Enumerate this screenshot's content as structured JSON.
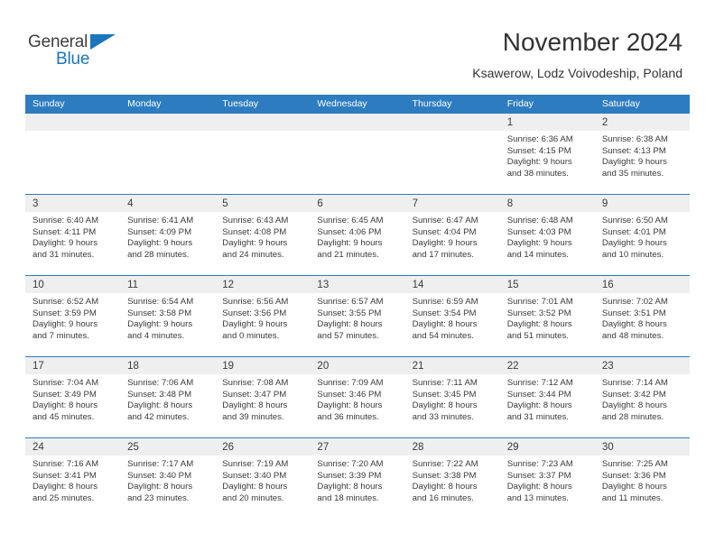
{
  "logo": {
    "word1": "General",
    "word2": "Blue",
    "triangle_color": "#1a75bb",
    "word1_color": "#3d3d3d",
    "word2_color": "#1a75bb"
  },
  "header": {
    "title": "November 2024",
    "subtitle": "Ksawerow, Lodz Voivodeship, Poland"
  },
  "theme": {
    "header_bg": "#2e7cc0",
    "header_text": "#ffffff",
    "day_band_bg": "#efefef",
    "cell_bg": "#ffffff",
    "text": "#3a3a3a"
  },
  "weekday_headers": [
    "Sunday",
    "Monday",
    "Tuesday",
    "Wednesday",
    "Thursday",
    "Friday",
    "Saturday"
  ],
  "weeks": [
    [
      {
        "day": "",
        "empty": true
      },
      {
        "day": "",
        "empty": true
      },
      {
        "day": "",
        "empty": true
      },
      {
        "day": "",
        "empty": true
      },
      {
        "day": "",
        "empty": true
      },
      {
        "day": "1",
        "sunrise": "Sunrise: 6:36 AM",
        "sunset": "Sunset: 4:15 PM",
        "daylight1": "Daylight: 9 hours",
        "daylight2": "and 38 minutes."
      },
      {
        "day": "2",
        "sunrise": "Sunrise: 6:38 AM",
        "sunset": "Sunset: 4:13 PM",
        "daylight1": "Daylight: 9 hours",
        "daylight2": "and 35 minutes."
      }
    ],
    [
      {
        "day": "3",
        "sunrise": "Sunrise: 6:40 AM",
        "sunset": "Sunset: 4:11 PM",
        "daylight1": "Daylight: 9 hours",
        "daylight2": "and 31 minutes."
      },
      {
        "day": "4",
        "sunrise": "Sunrise: 6:41 AM",
        "sunset": "Sunset: 4:09 PM",
        "daylight1": "Daylight: 9 hours",
        "daylight2": "and 28 minutes."
      },
      {
        "day": "5",
        "sunrise": "Sunrise: 6:43 AM",
        "sunset": "Sunset: 4:08 PM",
        "daylight1": "Daylight: 9 hours",
        "daylight2": "and 24 minutes."
      },
      {
        "day": "6",
        "sunrise": "Sunrise: 6:45 AM",
        "sunset": "Sunset: 4:06 PM",
        "daylight1": "Daylight: 9 hours",
        "daylight2": "and 21 minutes."
      },
      {
        "day": "7",
        "sunrise": "Sunrise: 6:47 AM",
        "sunset": "Sunset: 4:04 PM",
        "daylight1": "Daylight: 9 hours",
        "daylight2": "and 17 minutes."
      },
      {
        "day": "8",
        "sunrise": "Sunrise: 6:48 AM",
        "sunset": "Sunset: 4:03 PM",
        "daylight1": "Daylight: 9 hours",
        "daylight2": "and 14 minutes."
      },
      {
        "day": "9",
        "sunrise": "Sunrise: 6:50 AM",
        "sunset": "Sunset: 4:01 PM",
        "daylight1": "Daylight: 9 hours",
        "daylight2": "and 10 minutes."
      }
    ],
    [
      {
        "day": "10",
        "sunrise": "Sunrise: 6:52 AM",
        "sunset": "Sunset: 3:59 PM",
        "daylight1": "Daylight: 9 hours",
        "daylight2": "and 7 minutes."
      },
      {
        "day": "11",
        "sunrise": "Sunrise: 6:54 AM",
        "sunset": "Sunset: 3:58 PM",
        "daylight1": "Daylight: 9 hours",
        "daylight2": "and 4 minutes."
      },
      {
        "day": "12",
        "sunrise": "Sunrise: 6:56 AM",
        "sunset": "Sunset: 3:56 PM",
        "daylight1": "Daylight: 9 hours",
        "daylight2": "and 0 minutes."
      },
      {
        "day": "13",
        "sunrise": "Sunrise: 6:57 AM",
        "sunset": "Sunset: 3:55 PM",
        "daylight1": "Daylight: 8 hours",
        "daylight2": "and 57 minutes."
      },
      {
        "day": "14",
        "sunrise": "Sunrise: 6:59 AM",
        "sunset": "Sunset: 3:54 PM",
        "daylight1": "Daylight: 8 hours",
        "daylight2": "and 54 minutes."
      },
      {
        "day": "15",
        "sunrise": "Sunrise: 7:01 AM",
        "sunset": "Sunset: 3:52 PM",
        "daylight1": "Daylight: 8 hours",
        "daylight2": "and 51 minutes."
      },
      {
        "day": "16",
        "sunrise": "Sunrise: 7:02 AM",
        "sunset": "Sunset: 3:51 PM",
        "daylight1": "Daylight: 8 hours",
        "daylight2": "and 48 minutes."
      }
    ],
    [
      {
        "day": "17",
        "sunrise": "Sunrise: 7:04 AM",
        "sunset": "Sunset: 3:49 PM",
        "daylight1": "Daylight: 8 hours",
        "daylight2": "and 45 minutes."
      },
      {
        "day": "18",
        "sunrise": "Sunrise: 7:06 AM",
        "sunset": "Sunset: 3:48 PM",
        "daylight1": "Daylight: 8 hours",
        "daylight2": "and 42 minutes."
      },
      {
        "day": "19",
        "sunrise": "Sunrise: 7:08 AM",
        "sunset": "Sunset: 3:47 PM",
        "daylight1": "Daylight: 8 hours",
        "daylight2": "and 39 minutes."
      },
      {
        "day": "20",
        "sunrise": "Sunrise: 7:09 AM",
        "sunset": "Sunset: 3:46 PM",
        "daylight1": "Daylight: 8 hours",
        "daylight2": "and 36 minutes."
      },
      {
        "day": "21",
        "sunrise": "Sunrise: 7:11 AM",
        "sunset": "Sunset: 3:45 PM",
        "daylight1": "Daylight: 8 hours",
        "daylight2": "and 33 minutes."
      },
      {
        "day": "22",
        "sunrise": "Sunrise: 7:12 AM",
        "sunset": "Sunset: 3:44 PM",
        "daylight1": "Daylight: 8 hours",
        "daylight2": "and 31 minutes."
      },
      {
        "day": "23",
        "sunrise": "Sunrise: 7:14 AM",
        "sunset": "Sunset: 3:42 PM",
        "daylight1": "Daylight: 8 hours",
        "daylight2": "and 28 minutes."
      }
    ],
    [
      {
        "day": "24",
        "sunrise": "Sunrise: 7:16 AM",
        "sunset": "Sunset: 3:41 PM",
        "daylight1": "Daylight: 8 hours",
        "daylight2": "and 25 minutes."
      },
      {
        "day": "25",
        "sunrise": "Sunrise: 7:17 AM",
        "sunset": "Sunset: 3:40 PM",
        "daylight1": "Daylight: 8 hours",
        "daylight2": "and 23 minutes."
      },
      {
        "day": "26",
        "sunrise": "Sunrise: 7:19 AM",
        "sunset": "Sunset: 3:40 PM",
        "daylight1": "Daylight: 8 hours",
        "daylight2": "and 20 minutes."
      },
      {
        "day": "27",
        "sunrise": "Sunrise: 7:20 AM",
        "sunset": "Sunset: 3:39 PM",
        "daylight1": "Daylight: 8 hours",
        "daylight2": "and 18 minutes."
      },
      {
        "day": "28",
        "sunrise": "Sunrise: 7:22 AM",
        "sunset": "Sunset: 3:38 PM",
        "daylight1": "Daylight: 8 hours",
        "daylight2": "and 16 minutes."
      },
      {
        "day": "29",
        "sunrise": "Sunrise: 7:23 AM",
        "sunset": "Sunset: 3:37 PM",
        "daylight1": "Daylight: 8 hours",
        "daylight2": "and 13 minutes."
      },
      {
        "day": "30",
        "sunrise": "Sunrise: 7:25 AM",
        "sunset": "Sunset: 3:36 PM",
        "daylight1": "Daylight: 8 hours",
        "daylight2": "and 11 minutes."
      }
    ]
  ]
}
